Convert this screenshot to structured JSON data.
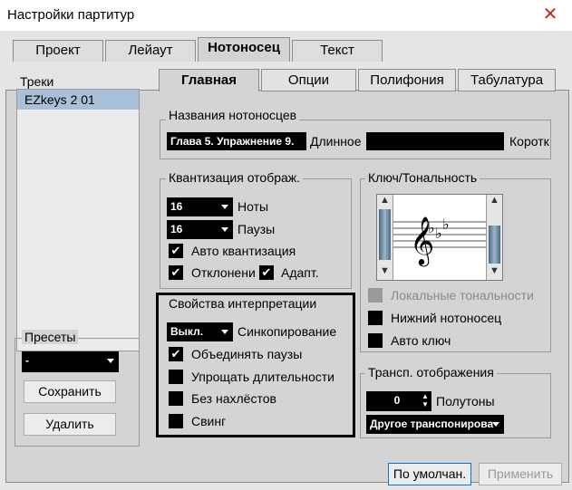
{
  "window": {
    "title": "Настройки партитур"
  },
  "tabs": [
    "Проект",
    "Лейаут",
    "Нотоносец",
    "Текст"
  ],
  "tracks": {
    "label": "Треки",
    "items": [
      "EZkeys 2 01"
    ]
  },
  "presets": {
    "label": "Пресеты",
    "value": "-",
    "save_label": "Сохранить",
    "delete_label": "Удалить"
  },
  "subtabs": [
    "Главная",
    "Опции",
    "Полифония",
    "Табулатура"
  ],
  "staff_names": {
    "title": "Названия нотоносцев",
    "short_value": "Глава 5. Упражнение 9.",
    "long_label": "Длинное",
    "long_value": "",
    "short_label": "Коротк"
  },
  "quantize": {
    "title": "Квантизация отображ.",
    "notes_value": "16",
    "notes_label": "Ноты",
    "rests_value": "16",
    "rests_label": "Паузы",
    "auto_label": "Авто квантизация",
    "deviation_label": "Отклонени",
    "adapt_label": "Адапт."
  },
  "clef": {
    "title": "Ключ/Тональность",
    "local_keys_label": "Локальные тональности",
    "lower_staff_label": "Нижний нотоносец",
    "auto_clef_label": "Авто ключ"
  },
  "interp": {
    "title": "Свойства интерпретации",
    "sync_value": "Выкл.",
    "sync_label": "Синкопирование",
    "merge_rests_label": "Объединять паузы",
    "simplify_label": "Упрощать длительности",
    "no_overlap_label": "Без нахлёстов",
    "swing_label": "Свинг"
  },
  "transpose": {
    "title": "Трансп. отображения",
    "semitones_value": "0",
    "semitones_label": "Полутоны",
    "other_value": "Другое транспонирова"
  },
  "footer": {
    "default_label": "По умолчан.",
    "apply_label": "Применить"
  },
  "check": "✔",
  "colors": {
    "accent": "#000000",
    "selection": "#a9c1d8",
    "close": "#c42b1c"
  }
}
